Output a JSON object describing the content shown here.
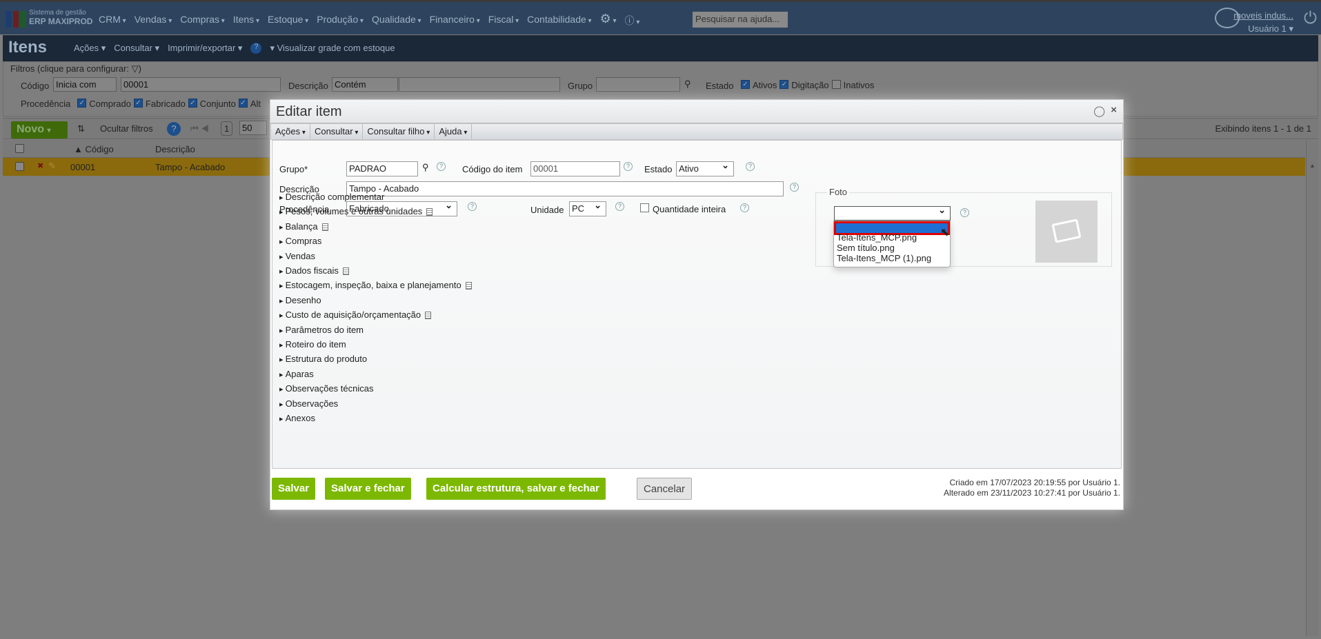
{
  "app": {
    "brand_line1": "Sistema de gestão",
    "brand_line2": "ERP MAXIPROD",
    "menu": [
      "CRM",
      "Vendas",
      "Compras",
      "Itens",
      "Estoque",
      "Produção",
      "Qualidade",
      "Financeiro",
      "Fiscal",
      "Contabilidade"
    ],
    "help_placeholder": "Pesquisar na ajuda...",
    "company": "moveis indus...",
    "user": "Usuário 1 ▾"
  },
  "page": {
    "title": "Itens",
    "menu": [
      "Ações ▾",
      "Consultar ▾",
      "Imprimir/exportar ▾",
      "▾ Visualizar grade com estoque"
    ]
  },
  "filters": {
    "legend": "Filtros (clique para configurar:",
    "codigo_label": "Código",
    "codigo_op": "Inicia com",
    "codigo_value": "00001",
    "descricao_label": "Descrição",
    "descricao_op": "Contém",
    "grupo_label": "Grupo",
    "estado_label": "Estado",
    "estado": [
      "Ativos",
      "Digitação",
      "Inativos"
    ],
    "procedencia_label": "Procedência",
    "procedencia": [
      "Comprado",
      "Fabricado",
      "Conjunto",
      "Alt"
    ]
  },
  "toolbar": {
    "novo": "Novo",
    "ocultar": "Ocultar filtros",
    "page": "1",
    "per_page": "50",
    "count": "Exibindo itens 1 - 1 de 1"
  },
  "grid": {
    "headers": [
      "▲ Código",
      "Descrição"
    ],
    "rows": [
      {
        "codigo": "00001",
        "descricao": "Tampo - Acabado"
      }
    ]
  },
  "modal": {
    "title": "Editar item",
    "menu": [
      "Ações",
      "Consultar",
      "Consultar filho",
      "Ajuda"
    ],
    "grupo_label": "Grupo*",
    "grupo": "PADRAO",
    "codigo_label": "Código do item",
    "codigo": "00001",
    "estado_label": "Estado",
    "estado": "Ativo",
    "descricao_label": "Descrição",
    "descricao": "Tampo - Acabado",
    "procedencia_label": "Procedência",
    "procedencia": "Fabricado",
    "unidade_label": "Unidade",
    "unidade": "PC",
    "qtd_inteira": "Quantidade inteira",
    "foto_legend": "Foto",
    "foto_options": [
      "",
      "Tela-Itens_MCP.png",
      "Sem título.png",
      "Tela-Itens_MCP (1).png"
    ],
    "sections": [
      "Descrição complementar",
      "Pesos, volumes e outras unidades",
      "Balança",
      "Compras",
      "Vendas",
      "Dados fiscais",
      "Estocagem, inspeção, baixa e planejamento",
      "Desenho",
      "Custo de aquisição/orçamentação",
      "Parâmetros do item",
      "Roteiro do item",
      "Estrutura do produto",
      "Aparas",
      "Observações técnicas",
      "Observações",
      "Anexos"
    ],
    "buttons": [
      "Salvar",
      "Salvar e fechar",
      "Calcular estrutura, salvar e fechar",
      "Cancelar"
    ],
    "created": "Criado em 17/07/2023 20:19:55 por Usuário 1.",
    "modified": "Alterado em 23/11/2023 10:27:41 por Usuário 1."
  }
}
